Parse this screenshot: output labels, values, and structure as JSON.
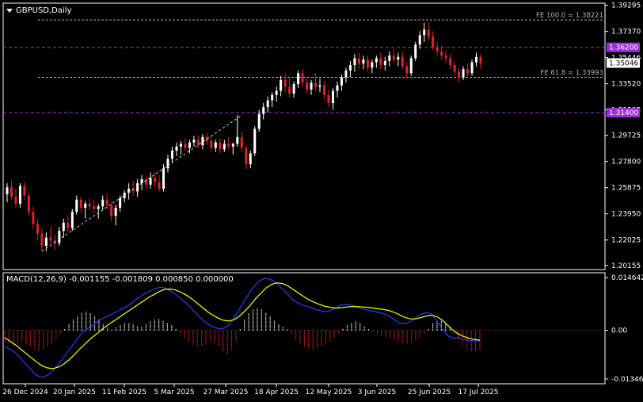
{
  "chart": {
    "symbol": "GBPUSD,Daily",
    "macd_label": "MACD(12,26,9) -0.001155 -0.001809 0.000850 0.000000"
  },
  "colors": {
    "background": "#000000",
    "frame": "#ffffff",
    "bull_candle": "#ffffff",
    "bear_candle": "#e0202a",
    "hline": "#9b30d9",
    "fibo": "#b0b0b0",
    "macd_line": "#2040ff",
    "signal_line": "#ffff00",
    "hist_pos": "#ffffff",
    "hist_neg": "#e0202a"
  },
  "chart_data": [
    {
      "type": "candlestick",
      "title": "GBPUSD,Daily",
      "price_axis_ticks": [
        "1.39295",
        "1.37370",
        "1.35446",
        "1.33520",
        "1.31595",
        "1.29725",
        "1.27800",
        "1.25875",
        "1.23950",
        "1.22025",
        "1.20155"
      ],
      "price_range": [
        1.1985,
        1.3945
      ],
      "date_labels": [
        "26 Dec 2024",
        "20 Jan 2025",
        "11 Feb 2025",
        "5 Mar 2025",
        "27 Mar 2025",
        "18 Apr 2025",
        "12 May 2025",
        "3 Jun 2025",
        "25 Jun 2025",
        "17 Jul 2025"
      ],
      "horizontal_lines": [
        {
          "price": 1.362,
          "label": "1.36200"
        },
        {
          "price": 1.314,
          "label": "1.31400"
        }
      ],
      "fibo_levels": [
        {
          "price": 1.38221,
          "label": "FE 100.0 = 1.38221"
        },
        {
          "price": 1.33993,
          "label": "FE 61.8 = 1.33993"
        }
      ],
      "current_price": {
        "price": 1.35046,
        "label": "1.35046"
      },
      "ohlc": [
        [
          1.254,
          1.262,
          1.248,
          1.259
        ],
        [
          1.259,
          1.264,
          1.25,
          1.252
        ],
        [
          1.252,
          1.258,
          1.244,
          1.247
        ],
        [
          1.247,
          1.262,
          1.244,
          1.26
        ],
        [
          1.26,
          1.263,
          1.25,
          1.253
        ],
        [
          1.253,
          1.256,
          1.238,
          1.241
        ],
        [
          1.241,
          1.245,
          1.228,
          1.232
        ],
        [
          1.232,
          1.236,
          1.22,
          1.225
        ],
        [
          1.225,
          1.229,
          1.212,
          1.216
        ],
        [
          1.216,
          1.226,
          1.212,
          1.222
        ],
        [
          1.222,
          1.23,
          1.218,
          1.22
        ],
        [
          1.22,
          1.224,
          1.213,
          1.218
        ],
        [
          1.218,
          1.23,
          1.216,
          1.227
        ],
        [
          1.227,
          1.236,
          1.222,
          1.233
        ],
        [
          1.233,
          1.238,
          1.226,
          1.229
        ],
        [
          1.229,
          1.243,
          1.227,
          1.241
        ],
        [
          1.241,
          1.253,
          1.239,
          1.25
        ],
        [
          1.25,
          1.252,
          1.24,
          1.244
        ],
        [
          1.244,
          1.249,
          1.236,
          1.247
        ],
        [
          1.247,
          1.251,
          1.242,
          1.245
        ],
        [
          1.245,
          1.25,
          1.24,
          1.243
        ],
        [
          1.243,
          1.247,
          1.236,
          1.245
        ],
        [
          1.245,
          1.253,
          1.242,
          1.25
        ],
        [
          1.25,
          1.254,
          1.243,
          1.246
        ],
        [
          1.246,
          1.248,
          1.234,
          1.238
        ],
        [
          1.238,
          1.246,
          1.231,
          1.244
        ],
        [
          1.244,
          1.253,
          1.241,
          1.251
        ],
        [
          1.251,
          1.257,
          1.248,
          1.255
        ],
        [
          1.255,
          1.262,
          1.25,
          1.258
        ],
        [
          1.258,
          1.264,
          1.253,
          1.256
        ],
        [
          1.256,
          1.265,
          1.252,
          1.262
        ],
        [
          1.262,
          1.268,
          1.257,
          1.265
        ],
        [
          1.265,
          1.267,
          1.258,
          1.261
        ],
        [
          1.261,
          1.27,
          1.258,
          1.266
        ],
        [
          1.266,
          1.27,
          1.259,
          1.263
        ],
        [
          1.263,
          1.268,
          1.256,
          1.258
        ],
        [
          1.258,
          1.276,
          1.256,
          1.273
        ],
        [
          1.273,
          1.283,
          1.27,
          1.28
        ],
        [
          1.28,
          1.289,
          1.277,
          1.286
        ],
        [
          1.286,
          1.292,
          1.282,
          1.289
        ],
        [
          1.289,
          1.293,
          1.283,
          1.291
        ],
        [
          1.291,
          1.295,
          1.286,
          1.288
        ],
        [
          1.288,
          1.294,
          1.284,
          1.292
        ],
        [
          1.292,
          1.297,
          1.289,
          1.294
        ],
        [
          1.294,
          1.297,
          1.288,
          1.29
        ],
        [
          1.29,
          1.298,
          1.287,
          1.296
        ],
        [
          1.296,
          1.299,
          1.29,
          1.293
        ],
        [
          1.293,
          1.297,
          1.285,
          1.288
        ],
        [
          1.288,
          1.294,
          1.285,
          1.292
        ],
        [
          1.292,
          1.295,
          1.284,
          1.287
        ],
        [
          1.287,
          1.294,
          1.285,
          1.291
        ],
        [
          1.291,
          1.296,
          1.287,
          1.289
        ],
        [
          1.289,
          1.292,
          1.283,
          1.291
        ],
        [
          1.291,
          1.312,
          1.289,
          1.296
        ],
        [
          1.296,
          1.3,
          1.285,
          1.288
        ],
        [
          1.288,
          1.29,
          1.272,
          1.276
        ],
        [
          1.276,
          1.286,
          1.273,
          1.284
        ],
        [
          1.284,
          1.304,
          1.282,
          1.302
        ],
        [
          1.302,
          1.316,
          1.3,
          1.313
        ],
        [
          1.313,
          1.321,
          1.309,
          1.318
        ],
        [
          1.318,
          1.326,
          1.314,
          1.323
        ],
        [
          1.323,
          1.329,
          1.318,
          1.327
        ],
        [
          1.327,
          1.333,
          1.322,
          1.33
        ],
        [
          1.33,
          1.341,
          1.326,
          1.338
        ],
        [
          1.338,
          1.343,
          1.329,
          1.333
        ],
        [
          1.333,
          1.34,
          1.325,
          1.328
        ],
        [
          1.328,
          1.337,
          1.325,
          1.335
        ],
        [
          1.335,
          1.345,
          1.332,
          1.343
        ],
        [
          1.343,
          1.346,
          1.333,
          1.336
        ],
        [
          1.336,
          1.34,
          1.328,
          1.331
        ],
        [
          1.331,
          1.338,
          1.327,
          1.336
        ],
        [
          1.336,
          1.343,
          1.33,
          1.333
        ],
        [
          1.333,
          1.339,
          1.329,
          1.334
        ],
        [
          1.334,
          1.337,
          1.324,
          1.327
        ],
        [
          1.327,
          1.331,
          1.318,
          1.321
        ],
        [
          1.321,
          1.332,
          1.316,
          1.33
        ],
        [
          1.33,
          1.337,
          1.325,
          1.334
        ],
        [
          1.334,
          1.342,
          1.33,
          1.34
        ],
        [
          1.34,
          1.347,
          1.336,
          1.345
        ],
        [
          1.345,
          1.352,
          1.34,
          1.349
        ],
        [
          1.349,
          1.357,
          1.344,
          1.354
        ],
        [
          1.354,
          1.358,
          1.346,
          1.35
        ],
        [
          1.35,
          1.356,
          1.346,
          1.353
        ],
        [
          1.353,
          1.356,
          1.344,
          1.347
        ],
        [
          1.347,
          1.353,
          1.343,
          1.351
        ],
        [
          1.351,
          1.356,
          1.347,
          1.354
        ],
        [
          1.354,
          1.358,
          1.346,
          1.349
        ],
        [
          1.349,
          1.355,
          1.345,
          1.352
        ],
        [
          1.352,
          1.359,
          1.348,
          1.356
        ],
        [
          1.356,
          1.361,
          1.351,
          1.353
        ],
        [
          1.353,
          1.358,
          1.348,
          1.355
        ],
        [
          1.355,
          1.359,
          1.346,
          1.348
        ],
        [
          1.348,
          1.351,
          1.34,
          1.343
        ],
        [
          1.343,
          1.356,
          1.341,
          1.354
        ],
        [
          1.354,
          1.366,
          1.352,
          1.364
        ],
        [
          1.364,
          1.374,
          1.361,
          1.371
        ],
        [
          1.371,
          1.38,
          1.366,
          1.375
        ],
        [
          1.375,
          1.38,
          1.367,
          1.37
        ],
        [
          1.37,
          1.374,
          1.36,
          1.362
        ],
        [
          1.362,
          1.366,
          1.356,
          1.359
        ],
        [
          1.359,
          1.363,
          1.353,
          1.356
        ],
        [
          1.356,
          1.36,
          1.35,
          1.354
        ],
        [
          1.354,
          1.357,
          1.346,
          1.349
        ],
        [
          1.349,
          1.352,
          1.341,
          1.344
        ],
        [
          1.344,
          1.347,
          1.336,
          1.34
        ],
        [
          1.34,
          1.348,
          1.338,
          1.346
        ],
        [
          1.346,
          1.35,
          1.34,
          1.343
        ],
        [
          1.343,
          1.353,
          1.341,
          1.351
        ],
        [
          1.351,
          1.358,
          1.348,
          1.355
        ],
        [
          1.355,
          1.357,
          1.346,
          1.35
        ]
      ]
    },
    {
      "type": "bar",
      "title": "MACD(12,26,9) -0.001155 -0.001809 0.000850 0.000000",
      "y_axis_ticks": [
        "0.014642",
        "0.00",
        "-0.013461"
      ],
      "y_range": [
        -0.0148,
        0.016
      ],
      "histogram": [
        -0.003,
        -0.0035,
        -0.004,
        -0.0038,
        -0.0033,
        -0.0038,
        -0.0045,
        -0.0052,
        -0.0058,
        -0.0052,
        -0.0045,
        -0.0038,
        -0.0025,
        -0.001,
        0.0005,
        0.0018,
        0.003,
        0.004,
        0.005,
        0.0052,
        0.0048,
        0.004,
        0.003,
        0.0018,
        0.0008,
        0.0002,
        0.0008,
        0.0015,
        0.002,
        0.0022,
        0.0018,
        0.0012,
        0.001,
        0.0018,
        0.0025,
        0.003,
        0.0032,
        0.0028,
        0.0022,
        0.0015,
        0.0005,
        -0.001,
        -0.0022,
        -0.0032,
        -0.004,
        -0.0045,
        -0.0042,
        -0.0038,
        -0.003,
        -0.0035,
        -0.0042,
        -0.006,
        -0.0068,
        -0.0055,
        -0.003,
        0.0005,
        0.003,
        0.0048,
        0.0058,
        0.0062,
        0.0058,
        0.005,
        0.004,
        0.0028,
        0.0018,
        0.001,
        0.0005,
        -0.001,
        -0.0025,
        -0.0038,
        -0.0045,
        -0.005,
        -0.0052,
        -0.005,
        -0.0045,
        -0.004,
        -0.0032,
        -0.002,
        -0.0008,
        0.0005,
        0.0015,
        0.0022,
        0.0025,
        0.002,
        0.0012,
        0.0005,
        -0.0005,
        -0.0012,
        -0.0015,
        -0.0018,
        -0.002,
        -0.0025,
        -0.003,
        -0.0035,
        -0.0038,
        -0.0035,
        -0.0028,
        -0.002,
        -0.001,
        0.0005,
        0.002,
        0.0028,
        0.003,
        0.002,
        0.0008,
        -0.0008,
        -0.0025,
        -0.004,
        -0.0052,
        -0.0058,
        -0.006,
        -0.0055
      ],
      "macd_line": [
        -0.0045,
        -0.0052,
        -0.0062,
        -0.0078,
        -0.0095,
        -0.011,
        -0.0125,
        -0.013,
        -0.0125,
        -0.0112,
        -0.0095,
        -0.0075,
        -0.0055,
        -0.0035,
        -0.0015,
        0.0,
        0.001,
        0.002,
        0.003,
        0.0038,
        0.0045,
        0.0052,
        0.006,
        0.0068,
        0.0078,
        0.009,
        0.01,
        0.0108,
        0.0115,
        0.012,
        0.0118,
        0.011,
        0.01,
        0.0088,
        0.0075,
        0.006,
        0.0045,
        0.003,
        0.0018,
        0.001,
        0.0005,
        0.0005,
        0.0015,
        0.0035,
        0.006,
        0.0085,
        0.0108,
        0.0128,
        0.014,
        0.0145,
        0.014,
        0.013,
        0.0115,
        0.01,
        0.0085,
        0.0075,
        0.007,
        0.0065,
        0.006,
        0.0055,
        0.0052,
        0.0055,
        0.0062,
        0.007,
        0.0072,
        0.007,
        0.0065,
        0.006,
        0.0056,
        0.0053,
        0.005,
        0.0046,
        0.004,
        0.003,
        0.002,
        0.0018,
        0.0025,
        0.0035,
        0.0045,
        0.005,
        0.0045,
        0.0025,
        0.0005,
        -0.0015,
        -0.0022,
        -0.002,
        -0.0025,
        -0.0028,
        -0.0029,
        -0.0029
      ],
      "signal_line": [
        -0.002,
        -0.003,
        -0.004,
        -0.0052,
        -0.0064,
        -0.0076,
        -0.0088,
        -0.0098,
        -0.0104,
        -0.0106,
        -0.0102,
        -0.0094,
        -0.0082,
        -0.0068,
        -0.0052,
        -0.0038,
        -0.0024,
        -0.0012,
        0.0,
        0.0012,
        0.0022,
        0.0032,
        0.0042,
        0.0052,
        0.0062,
        0.0072,
        0.0082,
        0.0092,
        0.01,
        0.0108,
        0.0114,
        0.0115,
        0.0112,
        0.0106,
        0.0098,
        0.0088,
        0.0076,
        0.0064,
        0.0052,
        0.0042,
        0.0034,
        0.0028,
        0.0026,
        0.003,
        0.004,
        0.0054,
        0.007,
        0.0088,
        0.0104,
        0.0118,
        0.0128,
        0.0132,
        0.013,
        0.0124,
        0.0114,
        0.0104,
        0.0094,
        0.0085,
        0.0078,
        0.0072,
        0.0067,
        0.0064,
        0.0062,
        0.0063,
        0.0065,
        0.0066,
        0.0066,
        0.0065,
        0.0064,
        0.0062,
        0.006,
        0.0058,
        0.0055,
        0.005,
        0.0043,
        0.0036,
        0.0032,
        0.0032,
        0.0036,
        0.004,
        0.0042,
        0.0038,
        0.0028,
        0.0014,
        0.0,
        -0.001,
        -0.0017,
        -0.0022,
        -0.0025,
        -0.0027
      ]
    }
  ]
}
